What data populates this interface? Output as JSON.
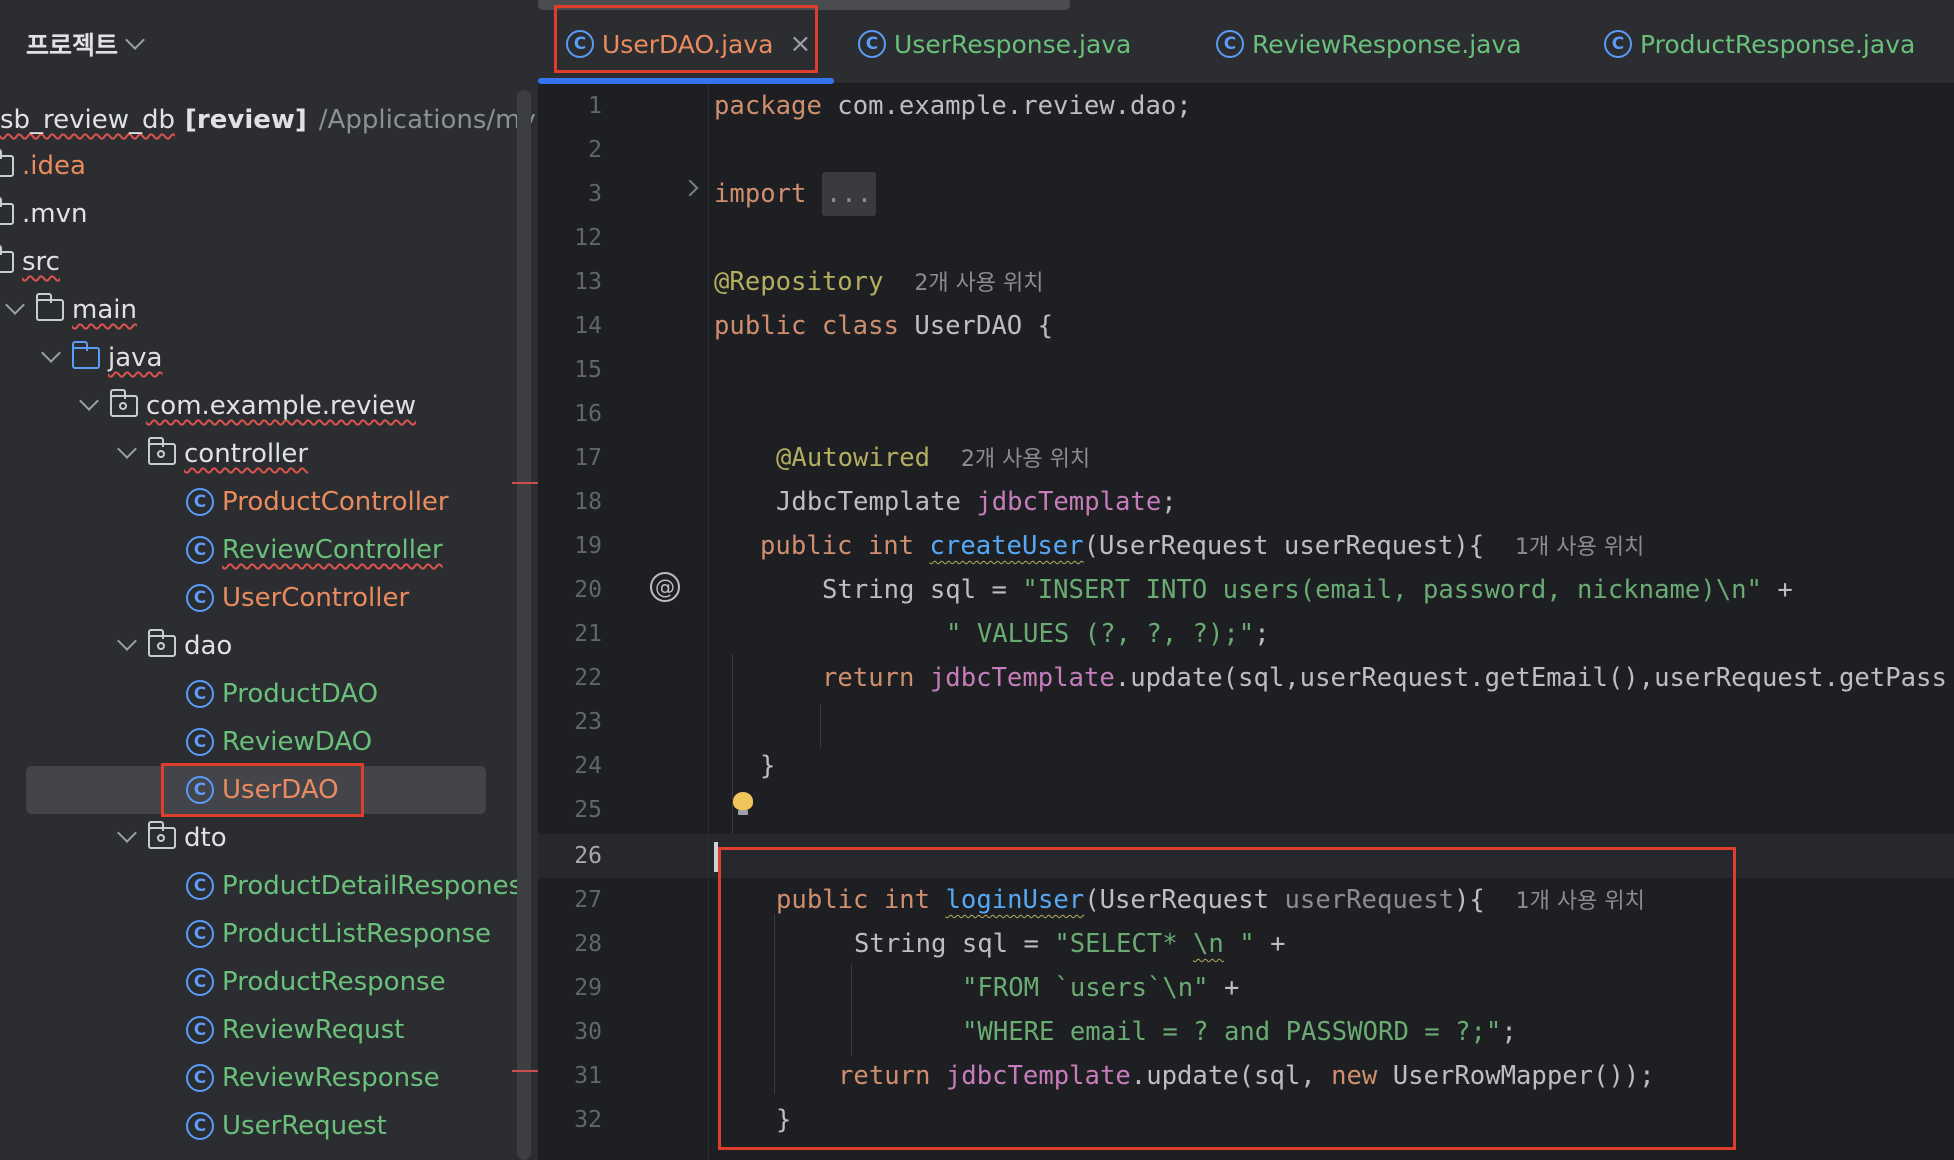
{
  "sidebar": {
    "title": "프로젝트",
    "root": {
      "name": "sb_review_db",
      "module": "[review]",
      "path": "/Applications/mybe"
    },
    "items": [
      {
        "label": ".idea",
        "kind": "folder"
      },
      {
        "label": ".mvn",
        "kind": "folder"
      },
      {
        "label": "src",
        "kind": "folder"
      },
      {
        "label": "main",
        "kind": "folder"
      },
      {
        "label": "java",
        "kind": "folder"
      },
      {
        "label": "com.example.review",
        "kind": "package"
      },
      {
        "label": "controller",
        "kind": "package"
      },
      {
        "label": "ProductController",
        "kind": "class"
      },
      {
        "label": "ReviewController",
        "kind": "class"
      },
      {
        "label": "UserController",
        "kind": "class"
      },
      {
        "label": "dao",
        "kind": "package"
      },
      {
        "label": "ProductDAO",
        "kind": "class"
      },
      {
        "label": "ReviewDAO",
        "kind": "class"
      },
      {
        "label": "UserDAO",
        "kind": "class"
      },
      {
        "label": "dto",
        "kind": "package"
      },
      {
        "label": "ProductDetailRespones",
        "kind": "class"
      },
      {
        "label": "ProductListResponse",
        "kind": "class"
      },
      {
        "label": "ProductResponse",
        "kind": "class"
      },
      {
        "label": "ReviewRequst",
        "kind": "class"
      },
      {
        "label": "ReviewResponse",
        "kind": "class"
      },
      {
        "label": "UserRequest",
        "kind": "class"
      }
    ]
  },
  "tabs": [
    {
      "label": "UserDAO.java",
      "active": true
    },
    {
      "label": "UserResponse.java",
      "active": false
    },
    {
      "label": "ReviewResponse.java",
      "active": false
    },
    {
      "label": "ProductResponse.java",
      "active": false
    }
  ],
  "icons": {
    "class_glyph": "C",
    "close_glyph": "×",
    "at_glyph": "@",
    "bulb": "lightbulb-icon"
  },
  "editor": {
    "line_numbers": [
      "1",
      "2",
      "3",
      "12",
      "13",
      "14",
      "15",
      "16",
      "17",
      "18",
      "19",
      "20",
      "21",
      "22",
      "23",
      "24",
      "25",
      "26",
      "27",
      "28",
      "29",
      "30",
      "31",
      "32"
    ],
    "current_line": "26",
    "lines": {
      "l1_kw": "package",
      "l1_rest": " com.example.review.dao;",
      "l3_kw": "import",
      "l3_fold": "...",
      "l13_ann": "@Repository",
      "l13_hint": "2개 사용 위치",
      "l14_kw": "public class",
      "l14_rest": " UserDAO {",
      "l17_ann": "@Autowired",
      "l17_hint": "2개 사용 위치",
      "l18_type": "JdbcTemplate ",
      "l18_field": "jdbcTemplate",
      "l18_end": ";",
      "l20_kw": "public int ",
      "l20_fn": "createUser",
      "l20_rest": "(UserRequest userRequest){",
      "l20_hint": "1개 사용 위치",
      "l21_pre": "String sql = ",
      "l21_str": "\"INSERT INTO users(email, password, nickname)\\n\"",
      "l21_post": " +",
      "l22_str": "\" VALUES (?, ?, ?);\"",
      "l22_post": ";",
      "l23_kw": "return ",
      "l23_field": "jdbcTemplate",
      "l23_rest": ".update(sql,userRequest.getEmail(),userRequest.getPass",
      "l25_brace": "}",
      "l27_kw": "public int ",
      "l27_fn": "loginUser",
      "l27_open": "(UserRequest ",
      "l27_param": "userRequest",
      "l27_close": "){",
      "l27_hint": "1개 사용 위치",
      "l28_pre": "String sql = ",
      "l28_str_a": "\"SELECT* ",
      "l28_str_b": "\\n",
      "l28_str_c": " \"",
      "l28_post": " +",
      "l29_str": "\"FROM `users`\\n\"",
      "l29_post": " +",
      "l30_str": "\"WHERE email = ? and PASSWORD = ?;\"",
      "l30_post": ";",
      "l31_kw": "return ",
      "l31_field": "jdbcTemplate",
      "l31_mid": ".update(sql, ",
      "l31_new": "new",
      "l31_rest": " UserRowMapper());",
      "l32_brace": "}"
    }
  }
}
